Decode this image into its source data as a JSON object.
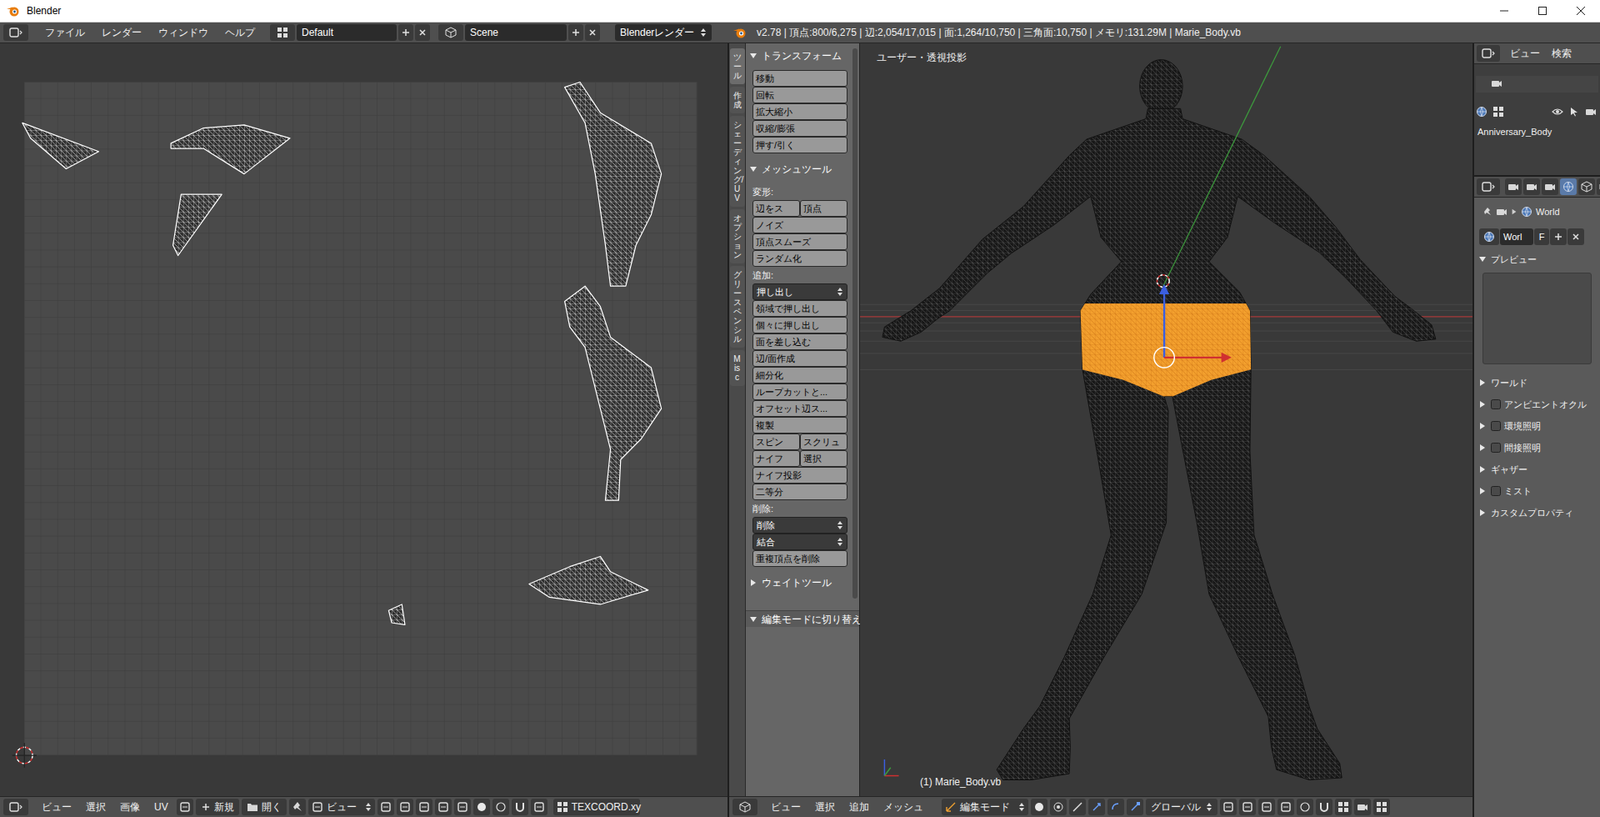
{
  "window": {
    "title": "Blender"
  },
  "info_bar": {
    "menus": [
      "ファイル",
      "レンダー",
      "ウィンドウ",
      "ヘルプ"
    ],
    "layout": "Default",
    "scene": "Scene",
    "engine": "Blenderレンダー",
    "stats": "v2.78 | 頂点:800/6,275 | 辺:2,054/17,015 | 面:1,264/10,750 | 三角面:10,750 | メモリ:131.29M | Marie_Body.vb"
  },
  "uv_header": {
    "menus": [
      "ビュー",
      "選択",
      "画像",
      "UV"
    ],
    "new": "新規",
    "open": "開く",
    "view_mode": "ビュー",
    "uv_map": "TEXCOORD.xy"
  },
  "tool_shelf": {
    "tabs": [
      {
        "label": "ツール",
        "selected": true
      },
      {
        "label": "作成",
        "selected": false
      },
      {
        "label": "シェーディング/UV",
        "selected": false
      },
      {
        "label": "オプション",
        "selected": false
      },
      {
        "label": "グリースペンシル",
        "selected": false
      },
      {
        "label": "Misc",
        "selected": false
      }
    ],
    "panels": [
      {
        "title": "トランスフォーム",
        "expanded": true,
        "rows": [
          {
            "kind": "buttons",
            "items": [
              "移動"
            ]
          },
          {
            "kind": "buttons",
            "items": [
              "回転"
            ]
          },
          {
            "kind": "buttons",
            "items": [
              "拡大縮小"
            ]
          },
          {
            "kind": "buttons",
            "items": [
              "収縮/膨張"
            ]
          },
          {
            "kind": "buttons",
            "items": [
              "押す/引く"
            ]
          }
        ]
      },
      {
        "title": "メッシュツール",
        "expanded": true,
        "rows": [
          {
            "kind": "label",
            "items": [
              "変形:"
            ]
          },
          {
            "kind": "buttons",
            "items": [
              "辺をス",
              "頂点"
            ]
          },
          {
            "kind": "buttons",
            "items": [
              "ノイズ"
            ]
          },
          {
            "kind": "buttons",
            "items": [
              "頂点スムーズ"
            ]
          },
          {
            "kind": "buttons",
            "items": [
              "ランダム化"
            ]
          },
          {
            "kind": "label",
            "items": [
              "追加:"
            ]
          },
          {
            "kind": "dropdown",
            "items": [
              "押し出し"
            ]
          },
          {
            "kind": "buttons",
            "items": [
              "領域で押し出し"
            ]
          },
          {
            "kind": "buttons",
            "items": [
              "個々に押し出し"
            ]
          },
          {
            "kind": "buttons",
            "items": [
              "面を差し込む"
            ]
          },
          {
            "kind": "buttons",
            "items": [
              "辺/面作成"
            ]
          },
          {
            "kind": "buttons",
            "items": [
              "細分化"
            ]
          },
          {
            "kind": "buttons",
            "items": [
              "ループカットと..."
            ]
          },
          {
            "kind": "buttons",
            "items": [
              "オフセット辺ス..."
            ]
          },
          {
            "kind": "buttons",
            "items": [
              "複製"
            ]
          },
          {
            "kind": "buttons",
            "items": [
              "スピン",
              "スクリュ"
            ]
          },
          {
            "kind": "buttons",
            "items": [
              "ナイフ",
              "選択"
            ]
          },
          {
            "kind": "buttons",
            "items": [
              "ナイフ投影"
            ]
          },
          {
            "kind": "buttons",
            "items": [
              "二等分"
            ]
          },
          {
            "kind": "label",
            "items": [
              "削除:"
            ]
          },
          {
            "kind": "dropdown",
            "items": [
              "削除"
            ]
          },
          {
            "kind": "dropdown",
            "items": [
              "結合"
            ]
          },
          {
            "kind": "buttons",
            "items": [
              "重複頂点を削除"
            ]
          }
        ]
      },
      {
        "title": "ウェイトツール",
        "expanded": false,
        "rows": []
      }
    ],
    "operator": {
      "title": "編集モードに切り替え...",
      "expanded": true
    }
  },
  "viewport": {
    "view_label": "ユーザー・透視投影",
    "object_label": "(1) Marie_Body.vb"
  },
  "view3d_header": {
    "menus": [
      "ビュー",
      "選択",
      "追加",
      "メッシュ"
    ],
    "mode": "編集モード",
    "orientation": "グローバル"
  },
  "outliner": {
    "menus": [
      "ビュー",
      "検索"
    ],
    "items": [
      {
        "label": "Anniversary_Body",
        "selected": false
      }
    ]
  },
  "properties": {
    "context": "World",
    "datablock": "Worl",
    "fake_user": "F",
    "sections": [
      {
        "label": "プレビュー",
        "expanded": true,
        "kind": "plain"
      },
      {
        "label": "ワールド",
        "expanded": false,
        "kind": "plain"
      },
      {
        "label": "アンビエントオクル",
        "expanded": false,
        "kind": "toggle",
        "checked": false
      },
      {
        "label": "環境照明",
        "expanded": false,
        "kind": "toggle",
        "checked": false
      },
      {
        "label": "間接照明",
        "expanded": false,
        "kind": "toggle",
        "checked": false
      },
      {
        "label": "ギャザー",
        "expanded": false,
        "kind": "plain"
      },
      {
        "label": "ミスト",
        "expanded": false,
        "kind": "toggle",
        "checked": false
      },
      {
        "label": "カスタムプロパティ",
        "expanded": false,
        "kind": "plain"
      }
    ]
  }
}
